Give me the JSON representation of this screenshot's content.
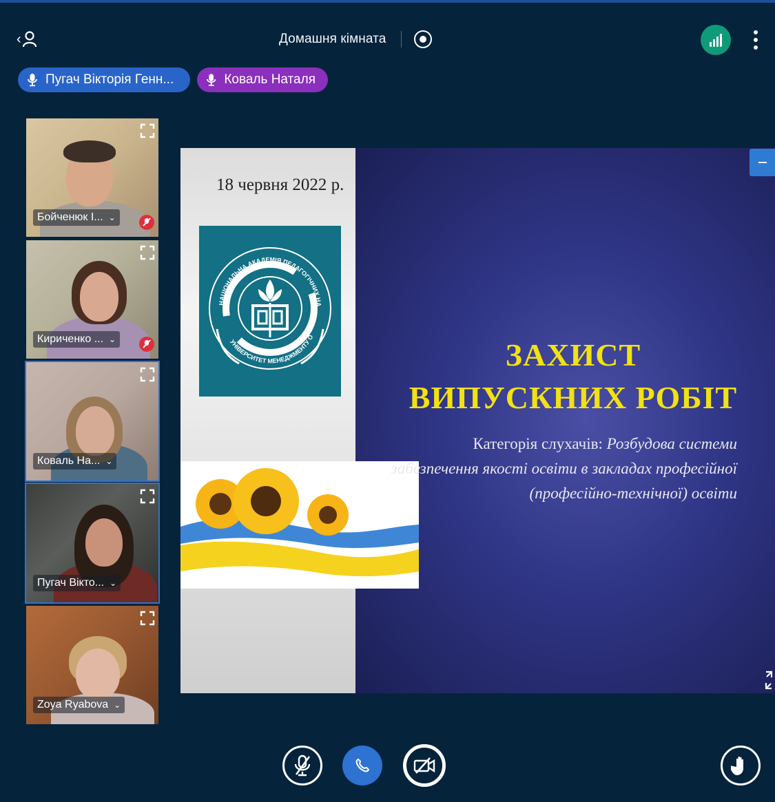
{
  "header": {
    "room_title": "Домашня кімната",
    "users_icon": "users-icon",
    "record_icon": "record-icon",
    "connection_icon": "connection-status-icon",
    "more_icon": "more-options-icon"
  },
  "talkers": [
    {
      "name": "Пугач Вікторія Генн...",
      "color": "#2964c9"
    },
    {
      "name": "Коваль Наталя",
      "color": "#8b2fbd"
    }
  ],
  "webcams": [
    {
      "name": "Бойченюк І...",
      "muted": true
    },
    {
      "name": "Кириченко ...",
      "muted": true
    },
    {
      "name": "Коваль На...",
      "muted": false
    },
    {
      "name": "Пугач Вікто...",
      "muted": false
    },
    {
      "name": "Zoya Ryabova",
      "muted": false
    }
  ],
  "slide": {
    "date": "18 червня 2022 р.",
    "title_line1": "ЗАХИСТ",
    "title_line2": "ВИПУСКНИХ РОБІТ",
    "category_label": "Категорія слухачів:",
    "category_value": "Розбудова системи забезпечення якості освіти в закладах професійної (професійно-технічної) освіти",
    "logo_ring_text": "НАЦІОНАЛЬНА АКАДЕМІЯ ПЕДАГОГІЧНИХ НАУК УКРАЇНИ",
    "logo_bottom_text": "УНІВЕРСИТЕТ МЕНЕДЖМЕНТУ ОСВІТИ"
  },
  "controls": {
    "mic_icon": "microphone-muted-icon",
    "leave_icon": "phone-icon",
    "camera_icon": "camera-off-icon",
    "hand_icon": "raise-hand-icon"
  },
  "colors": {
    "background": "#06233c",
    "accent": "#2e72d2",
    "connection": "#0f9b79",
    "slide_title": "#f3e112"
  }
}
